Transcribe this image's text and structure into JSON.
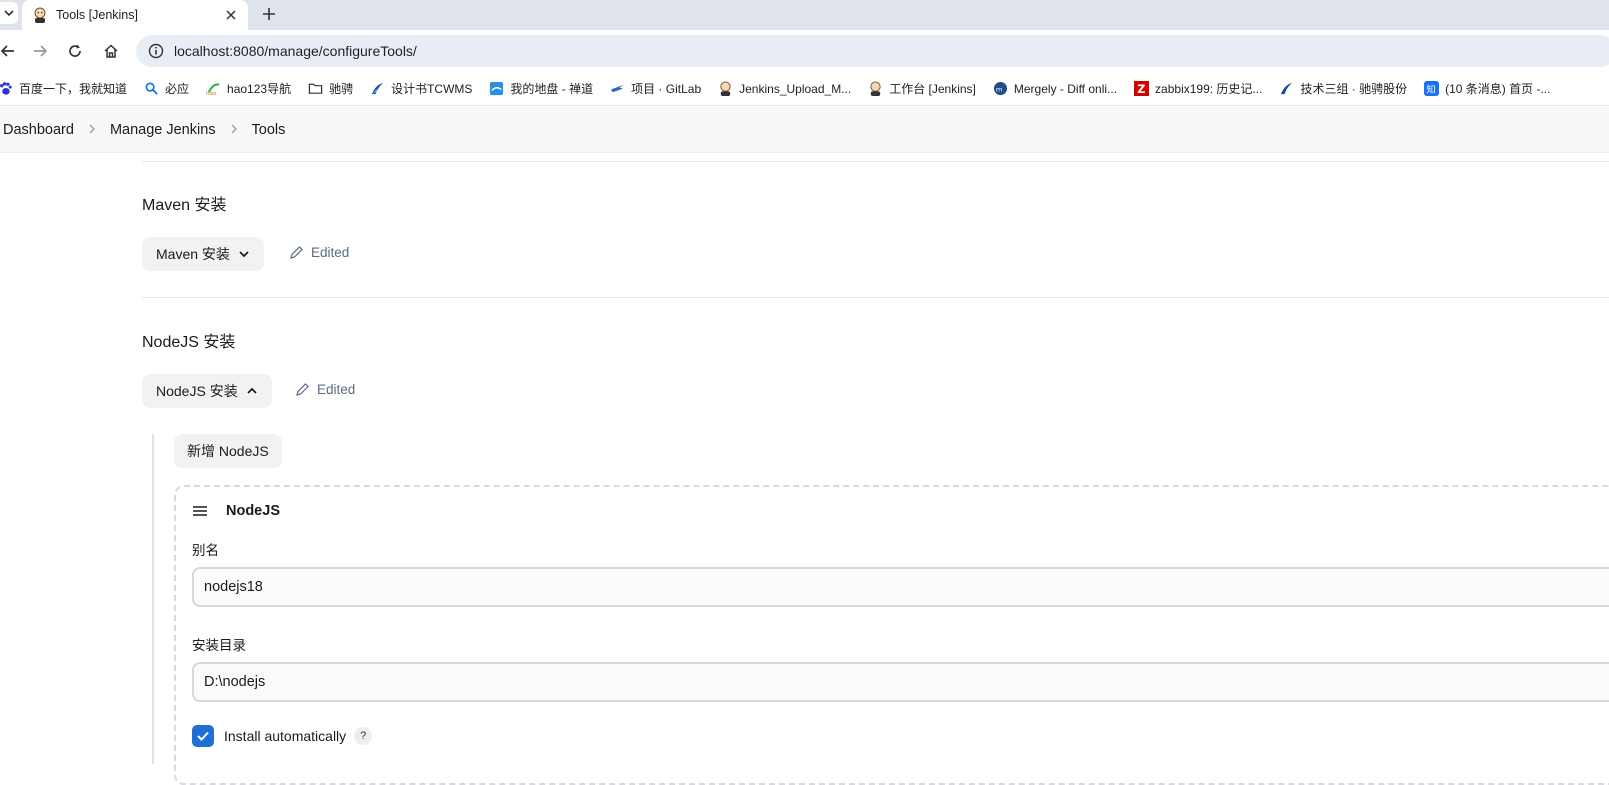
{
  "browser": {
    "tab_title": "Tools [Jenkins]",
    "url": "localhost:8080/manage/configureTools/"
  },
  "bookmarks": [
    {
      "label": "百度一下，我就知道",
      "icon": "baidu-icon"
    },
    {
      "label": "必应",
      "icon": "bing-search-icon"
    },
    {
      "label": "hao123导航",
      "icon": "hao123-icon"
    },
    {
      "label": "驰骋",
      "icon": "folder-icon"
    },
    {
      "label": "设计书TCWMS",
      "icon": "company-logo-icon"
    },
    {
      "label": "我的地盘 - 禅道",
      "icon": "zentao-icon"
    },
    {
      "label": "项目 · GitLab",
      "icon": "gitlab-icon"
    },
    {
      "label": "Jenkins_Upload_M...",
      "icon": "jenkins-icon"
    },
    {
      "label": "工作台 [Jenkins]",
      "icon": "jenkins-icon"
    },
    {
      "label": "Mergely - Diff onli...",
      "icon": "mergely-icon"
    },
    {
      "label": "zabbix199: 历史记...",
      "icon": "zabbix-icon"
    },
    {
      "label": "技术三组 · 驰骋股份",
      "icon": "company-logo-icon"
    },
    {
      "label": "(10 条消息) 首页 -...",
      "icon": "zhihu-icon"
    }
  ],
  "breadcrumb": [
    "Dashboard",
    "Manage Jenkins",
    "Tools"
  ],
  "maven": {
    "title": "Maven 安装",
    "button": "Maven 安装",
    "edited": "Edited"
  },
  "nodejs": {
    "title": "NodeJS 安装",
    "button": "NodeJS 安装",
    "edited": "Edited",
    "add_button": "新增 NodeJS",
    "card_title": "NodeJS",
    "alias_label": "别名",
    "alias_value": "nodejs18",
    "home_label": "安装目录",
    "home_value": "D:\\nodejs",
    "auto_install_label": "Install automatically",
    "help": "?"
  },
  "colors": {
    "accent": "#1f6fd6",
    "edited_text": "#5a6b80"
  }
}
